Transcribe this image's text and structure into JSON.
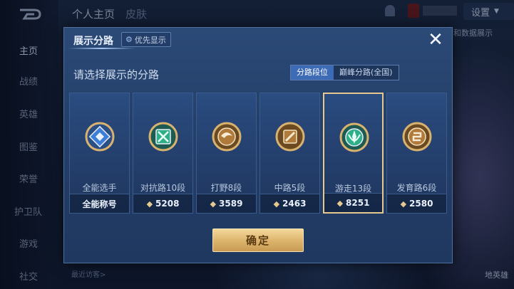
{
  "header": {
    "tabs": [
      "个人主页",
      "皮肤"
    ],
    "settings_label": "设置",
    "data_display_label": "和数据展示"
  },
  "sidebar": {
    "items": [
      {
        "label": "主页",
        "active": true
      },
      {
        "label": "战绩"
      },
      {
        "label": "英雄"
      },
      {
        "label": "图鉴"
      },
      {
        "label": "荣誉"
      },
      {
        "label": "护卫队"
      },
      {
        "label": "游戏"
      },
      {
        "label": "社交"
      }
    ]
  },
  "background": {
    "recent_visitors": "最近访客>",
    "right_label": "地英雄"
  },
  "dialog": {
    "title": "展示分路",
    "priority_label": "优先显示",
    "close_icon": "close-icon",
    "prompt": "请选择展示的分路",
    "segments": [
      {
        "label": "分路段位",
        "active": true
      },
      {
        "label": "巅峰分路(全国)",
        "active": false
      }
    ],
    "confirm_label": "确定",
    "cards": [
      {
        "name": "全能选手",
        "value": "全能称号",
        "icon": "all-round-badge-icon",
        "selected": false,
        "show_diamond": false
      },
      {
        "name": "对抗路10段",
        "value": "5208",
        "icon": "clash-lane-badge-icon",
        "selected": false,
        "show_diamond": true
      },
      {
        "name": "打野8段",
        "value": "3589",
        "icon": "jungle-badge-icon",
        "selected": false,
        "show_diamond": true
      },
      {
        "name": "中路5段",
        "value": "2463",
        "icon": "mid-lane-badge-icon",
        "selected": false,
        "show_diamond": true
      },
      {
        "name": "游走13段",
        "value": "8251",
        "icon": "roam-badge-icon",
        "selected": true,
        "show_diamond": true
      },
      {
        "name": "发育路6段",
        "value": "2580",
        "icon": "farm-lane-badge-icon",
        "selected": false,
        "show_diamond": true
      }
    ],
    "colors": {
      "accent_gold": "#e6c98e",
      "segment_active": "#3d6bb5",
      "badge_green": "#2fae8a",
      "badge_blue": "#3d7fd6"
    }
  }
}
